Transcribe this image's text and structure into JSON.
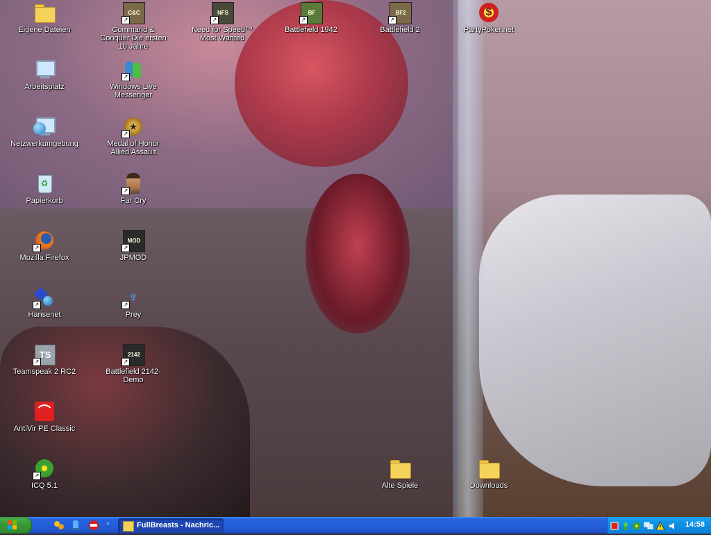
{
  "desktop": {
    "icons_col1": [
      {
        "label": "Eigene Dateien",
        "icon": "folder-documents-icon"
      },
      {
        "label": "Arbeitsplatz",
        "icon": "computer-icon"
      },
      {
        "label": "Netzwerkumgebung",
        "icon": "network-places-icon"
      },
      {
        "label": "Papierkorb",
        "icon": "recycle-bin-icon"
      },
      {
        "label": "Mozilla Firefox",
        "icon": "firefox-icon"
      },
      {
        "label": "Hansenet",
        "icon": "hansenet-icon"
      },
      {
        "label": "Teamspeak 2 RC2",
        "icon": "teamspeak-icon"
      },
      {
        "label": "AntiVir PE Classic",
        "icon": "antivir-icon"
      },
      {
        "label": "ICQ 5.1",
        "icon": "icq-icon"
      }
    ],
    "icons_col2": [
      {
        "label": "Command & Conquer Die ersten 10 Jahre",
        "icon": "command-conquer-icon"
      },
      {
        "label": "Windows Live Messenger",
        "icon": "messenger-icon"
      },
      {
        "label": "Medal of Honor Allied Assault",
        "icon": "medal-of-honor-icon"
      },
      {
        "label": "Far Cry",
        "icon": "far-cry-icon"
      },
      {
        "label": "JPMOD",
        "icon": "jpmod-icon"
      },
      {
        "label": "Prey",
        "icon": "prey-icon"
      },
      {
        "label": "Battlefield 2142-Demo",
        "icon": "battlefield-2142-icon"
      }
    ],
    "icons_top": [
      {
        "label": "Need for Speed™ Most Wanted",
        "icon": "nfs-icon",
        "glyph": "NFS"
      },
      {
        "label": "Battlefield 1942",
        "icon": "battlefield-1942-icon",
        "glyph": "BF"
      },
      {
        "label": "Battlefield 2",
        "icon": "battlefield-2-icon",
        "glyph": "BF2"
      },
      {
        "label": "PartyPoker.net",
        "icon": "partypoker-icon",
        "glyph": "$"
      }
    ],
    "icons_bottom": [
      {
        "label": "Alte Spiele",
        "icon": "folder-icon"
      },
      {
        "label": "Downloads",
        "icon": "folder-icon"
      }
    ],
    "shortcut_glyph": "↗",
    "recycle_glyph": "♻",
    "medal_glyph": "★",
    "prey_glyph": "♆",
    "antivir_glyph": "⌒",
    "teamspeak_glyph": "TS",
    "cnc_glyph": "C&C",
    "jpmod_glyph": "MOD",
    "bf2142_glyph": "2142"
  },
  "taskbar": {
    "start_icon": "windows-logo-icon",
    "quick_launch": [
      "quick-launch-app-icon",
      "quick-launch-messenger-icon",
      "quick-launch-game-icon"
    ],
    "quick_launch_more": "›",
    "task_button_label": "FullBreasts - Nachric...",
    "tray_icons": [
      "record-icon",
      "messenger-status-icon",
      "icq-tray-icon",
      "network-icon",
      "warning-icon",
      "volume-icon"
    ],
    "clock": "14:58"
  },
  "colors": {
    "taskbar": "#245edb",
    "start_button": "#3a9a3a",
    "tray": "#0e8ee3"
  }
}
